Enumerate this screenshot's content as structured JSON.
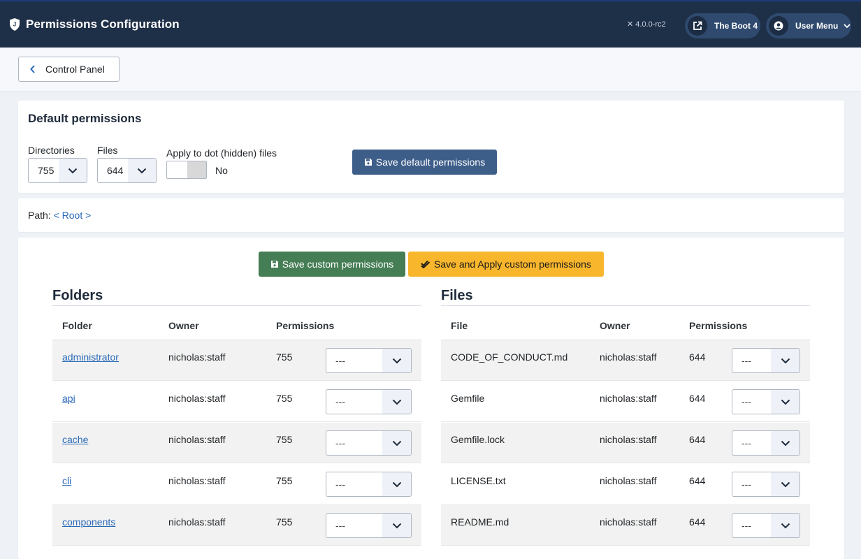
{
  "header": {
    "title": "Permissions Configuration",
    "version": "4.0.0-rc2",
    "site_button": "The Boot 4",
    "user_menu": "User Menu"
  },
  "toolbar": {
    "back_label": "Control Panel"
  },
  "defaults": {
    "title": "Default permissions",
    "directories_label": "Directories",
    "directories_value": "755",
    "files_label": "Files",
    "files_value": "644",
    "dot_label": "Apply to dot (hidden) files",
    "dot_value": "No",
    "save_label": "Save default permissions"
  },
  "path": {
    "label": "Path:",
    "root": "< Root >"
  },
  "actions": {
    "save_custom": "Save custom permissions",
    "apply_custom": "Save and Apply custom permissions"
  },
  "folders": {
    "title": "Folders",
    "headers": [
      "Folder",
      "Owner",
      "Permissions"
    ],
    "rows": [
      {
        "name": "administrator",
        "owner": "nicholas:staff",
        "perm": "755",
        "select": "---"
      },
      {
        "name": "api",
        "owner": "nicholas:staff",
        "perm": "755",
        "select": "---"
      },
      {
        "name": "cache",
        "owner": "nicholas:staff",
        "perm": "755",
        "select": "---"
      },
      {
        "name": "cli",
        "owner": "nicholas:staff",
        "perm": "755",
        "select": "---"
      },
      {
        "name": "components",
        "owner": "nicholas:staff",
        "perm": "755",
        "select": "---"
      }
    ]
  },
  "files": {
    "title": "Files",
    "headers": [
      "File",
      "Owner",
      "Permissions"
    ],
    "rows": [
      {
        "name": "CODE_OF_CONDUCT.md",
        "owner": "nicholas:staff",
        "perm": "644",
        "select": "---"
      },
      {
        "name": "Gemfile",
        "owner": "nicholas:staff",
        "perm": "644",
        "select": "---"
      },
      {
        "name": "Gemfile.lock",
        "owner": "nicholas:staff",
        "perm": "644",
        "select": "---"
      },
      {
        "name": "LICENSE.txt",
        "owner": "nicholas:staff",
        "perm": "644",
        "select": "---"
      },
      {
        "name": "README.md",
        "owner": "nicholas:staff",
        "perm": "644",
        "select": "---"
      }
    ]
  }
}
